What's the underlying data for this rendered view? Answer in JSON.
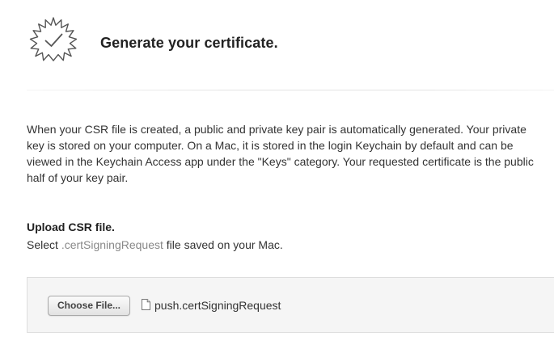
{
  "header": {
    "title": "Generate your certificate.",
    "badge_icon": "certificate-check-badge-icon"
  },
  "intro": {
    "text": "When your CSR file is created, a public and private key pair is automatically generated. Your private key is stored on your computer. On a Mac, it is stored in the login Keychain by default and can be viewed in the Keychain Access app under the \"Keys\" category. Your requested certificate is the public half of your key pair."
  },
  "upload": {
    "heading": "Upload CSR file.",
    "hint_prefix": "Select ",
    "hint_extension": ".certSigningRequest",
    "hint_suffix": " file saved on your Mac.",
    "choose_button_label": "Choose File...",
    "file_icon": "document-icon",
    "selected_file": "push.certSigningRequest"
  },
  "colors": {
    "text": "#333333",
    "heading": "#222222",
    "muted_extension": "#888888",
    "panel_background": "#f5f5f5",
    "panel_border": "#dddddd",
    "badge_stroke": "#555555"
  }
}
